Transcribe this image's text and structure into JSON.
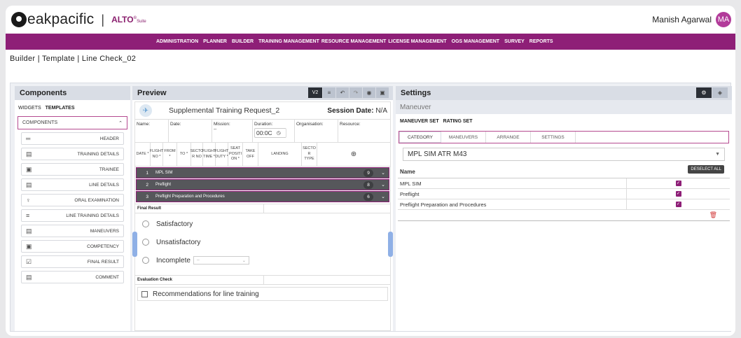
{
  "brand": {
    "name": "eakpacific",
    "separator": "|",
    "product": "ALTO",
    "product_sup": "©",
    "product_suffix": "Suite"
  },
  "user": {
    "name": "Manish Agarwal",
    "initials": "MA"
  },
  "nav": [
    "ADMINISTRATION",
    "PLANNER",
    "BUILDER",
    "TRAINING MANAGEMENT",
    "RESOURCE MANAGEMENT",
    "LICENSE MANAGEMENT",
    "OGS MANAGEMENT",
    "SURVEY",
    "REPORTS"
  ],
  "breadcrumb": "Builder | Template | Line Check_02",
  "components": {
    "title": "Components",
    "tab_widgets": "WIDGETS",
    "tab_templates": "TEMPLATES",
    "select_label": "COMPONENTS",
    "items": [
      {
        "label": "HEADER",
        "icon": "header-icon",
        "glyph": "═"
      },
      {
        "label": "TRAINING DETAILS",
        "icon": "table-icon",
        "glyph": "▤"
      },
      {
        "label": "TRAINEE",
        "icon": "person-card-icon",
        "glyph": "▣"
      },
      {
        "label": "LINE DETAILS",
        "icon": "table-icon",
        "glyph": "▤"
      },
      {
        "label": "ORAL EXAMINATION",
        "icon": "microphone-icon",
        "glyph": "♀"
      },
      {
        "label": "LINE TRAINING DETAILS",
        "icon": "list-icon",
        "glyph": "≡"
      },
      {
        "label": "MANEUVERS",
        "icon": "document-icon",
        "glyph": "▤"
      },
      {
        "label": "COMPETENCY",
        "icon": "card-icon",
        "glyph": "▣"
      },
      {
        "label": "FINAL RESULT",
        "icon": "checklist-icon",
        "glyph": "☑"
      },
      {
        "label": "COMMENT",
        "icon": "comment-icon",
        "glyph": "▤"
      }
    ]
  },
  "preview": {
    "title": "Preview",
    "toolbar": {
      "v2": "V2"
    },
    "form_title": "Supplemental Training Request_2",
    "session_label": "Session Date:",
    "session_value": "N/A",
    "fields": {
      "name": "Name:",
      "date": "Date:",
      "mission": "Mission:",
      "mission_value": "--",
      "duration": "Duration:",
      "duration_value": "00:0C",
      "organisation": "Organisation:",
      "resource": "Resource:"
    },
    "columns": [
      "DATE *",
      "FLIGHT NO *",
      "FROM *",
      "TO *",
      "SECTO R NO",
      "FLIGHT TIME *",
      "FLIGHT DUTY *",
      "SEAT POSITI ON *",
      "TAKE OFF",
      "LANDING",
      "SECTO R TYPE"
    ],
    "maneuver_rows": [
      {
        "n": "1",
        "label": "MPL SIM",
        "count": "9"
      },
      {
        "n": "2",
        "label": "Preflight",
        "count": "8"
      },
      {
        "n": "3",
        "label": "Preflight Preparation and Procedures",
        "count": "6"
      }
    ],
    "final_result": "Final Result",
    "options": [
      "Satisfactory",
      "Unsatisfactory",
      "Incomplete"
    ],
    "incomplete_select": "--",
    "evaluation": "Evaluation Check",
    "recommendation": "Recommendations for line training"
  },
  "settings": {
    "title": "Settings",
    "section": "Maneuver",
    "link_maneuver": "MANEUVER SET",
    "link_rating": "RATING SET",
    "tabs": [
      "CATEGORY",
      "MANEUVERS",
      "ARRANGE",
      "SETTINGS"
    ],
    "dropdown": "MPL SIM ATR M43",
    "table_header": "Name",
    "deselect": "DESELECT ALL",
    "rows": [
      "MPL SIM",
      "Preflight",
      "Preflight Preparation and Procedures"
    ]
  }
}
